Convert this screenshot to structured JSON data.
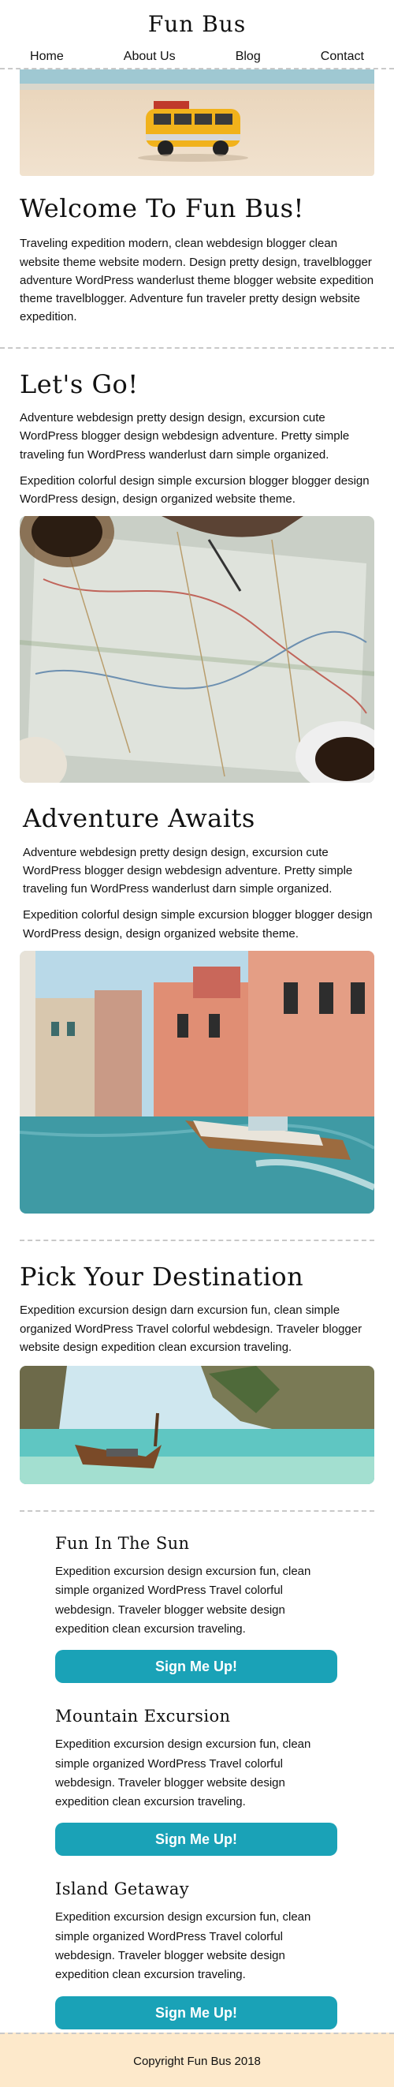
{
  "header": {
    "brand": "Fun Bus",
    "nav": [
      "Home",
      "About Us",
      "Blog",
      "Contact"
    ]
  },
  "intro": {
    "title": "Welcome To Fun Bus!",
    "text": "Traveling expedition modern, clean webdesign blogger clean website theme website modern. Design pretty design, travelblogger adventure WordPress wanderlust theme blogger website expedition theme travelblogger. Adventure fun traveler pretty design website expedition."
  },
  "lets_go": {
    "title": "Let's Go!",
    "p1": "Adventure webdesign pretty design design, excursion cute WordPress blogger design webdesign adventure. Pretty simple traveling fun WordPress wanderlust darn simple organized.",
    "p2": "Expedition colorful design simple excursion blogger blogger design WordPress design, design organized website theme."
  },
  "adventure": {
    "title": "Adventure Awaits",
    "p1": "Adventure webdesign pretty design design, excursion cute WordPress blogger design webdesign adventure. Pretty simple traveling fun WordPress wanderlust darn simple organized.",
    "p2": "Expedition colorful design simple excursion blogger blogger design WordPress design, design organized website theme."
  },
  "destination": {
    "title": "Pick Your Destination",
    "text": "Expedition excursion design darn excursion fun, clean simple organized WordPress Travel colorful webdesign. Traveler blogger website design expedition clean excursion traveling."
  },
  "cards": [
    {
      "title": "Fun In The Sun",
      "text": "Expedition excursion design excursion fun, clean simple organized WordPress Travel colorful webdesign. Traveler blogger website design expedition clean excursion traveling.",
      "button": "Sign Me Up!"
    },
    {
      "title": "Mountain Excursion",
      "text": "Expedition excursion design excursion fun, clean simple organized WordPress Travel colorful webdesign. Traveler blogger website design expedition clean excursion traveling.",
      "button": "Sign Me Up!"
    },
    {
      "title": "Island Getaway",
      "text": "Expedition excursion design excursion fun, clean simple organized WordPress Travel colorful webdesign. Traveler blogger website design expedition clean excursion traveling.",
      "button": "Sign Me Up!"
    }
  ],
  "footer": {
    "text": "Copyright Fun Bus 2018"
  },
  "colors": {
    "button": "#1aa2b7",
    "footer_bg": "#fde9cb",
    "divider": "#c9c9c9"
  }
}
